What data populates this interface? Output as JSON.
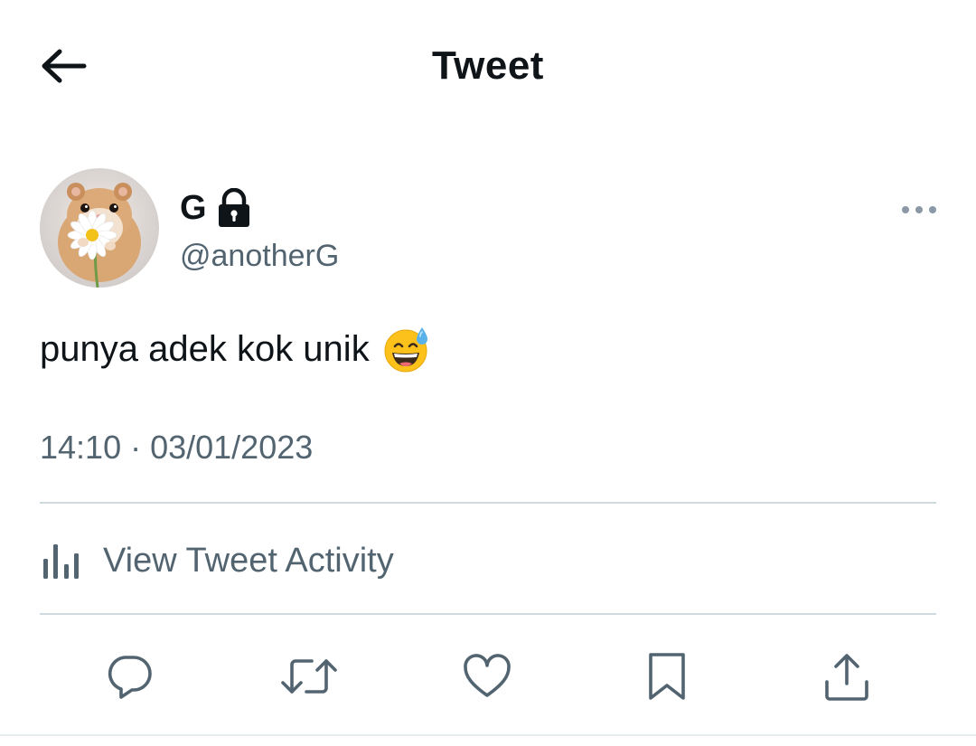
{
  "header": {
    "title": "Tweet",
    "back_icon": "arrow-left-icon"
  },
  "author": {
    "display_name": "G",
    "handle": "@anotherG",
    "protected_icon": "lock-icon",
    "avatar": "hamster-with-daisy-avatar"
  },
  "tweet": {
    "text": "punya adek kok unik",
    "emoji": "grinning-face-with-sweat-emoji",
    "timestamp": "14:10 · 03/01/2023"
  },
  "activity": {
    "label": "View Tweet Activity",
    "icon": "bar-chart-icon"
  },
  "actions": [
    "reply-icon",
    "retweet-icon",
    "like-icon",
    "bookmark-icon",
    "share-icon"
  ],
  "colors": {
    "text_primary": "#0f1419",
    "text_secondary": "#536471",
    "divider": "#cfd9de"
  }
}
